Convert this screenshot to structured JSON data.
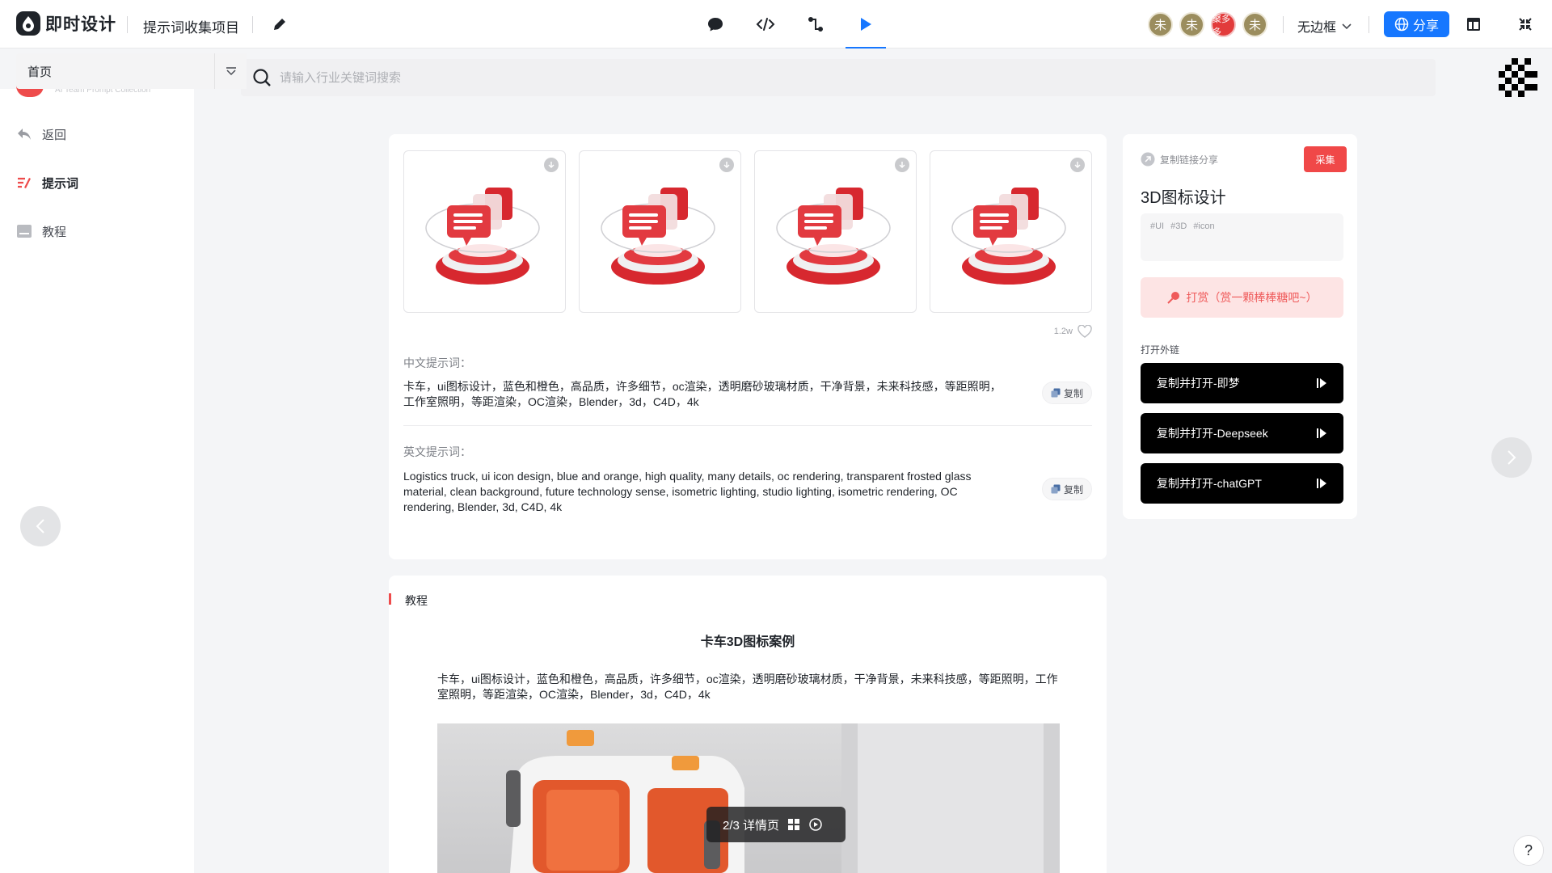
{
  "app": {
    "logo_text": "即时设计",
    "project_name": "提示词收集项目"
  },
  "mode_tabs": [
    {
      "icon": "comment-icon"
    },
    {
      "icon": "code-icon"
    },
    {
      "icon": "connect-icon"
    },
    {
      "icon": "play-icon",
      "active": true
    }
  ],
  "collaborators": [
    {
      "label": "未"
    },
    {
      "label": "未"
    },
    {
      "label": "聚多多"
    },
    {
      "label": "未"
    }
  ],
  "toolbar": {
    "frame_mode": "无边框",
    "share_label": "分享",
    "accent_color": "#1677ff"
  },
  "nav": {
    "page_select": "首页",
    "search_placeholder": "请输入行业关键词搜索",
    "search_value": ""
  },
  "sidebar": {
    "peek_text": "AI Team Prompt Collection",
    "items": [
      {
        "label": "返回",
        "icon": "back-icon"
      },
      {
        "label": "提示词",
        "icon": "prompt-icon",
        "active": true
      },
      {
        "label": "教程",
        "icon": "tutorial-icon"
      }
    ]
  },
  "detail": {
    "views": "1.2w",
    "cn_label": "中文提示词：",
    "cn_prompt": "卡车，ui图标设计，蓝色和橙色，高品质，许多细节，oc渲染，透明磨砂玻璃材质，干净背景，未来科技感，等距照明，工作室照明，等距渲染，OC渲染，Blender，3d，C4D，4k",
    "en_label": "英文提示词：",
    "en_prompt": "Logistics truck, ui icon design, blue and orange, high quality, many details, oc rendering, transparent frosted glass material, clean background, future technology sense, isometric lighting, studio lighting, isometric rendering, OC rendering, Blender, 3d, C4D, 4k",
    "copy_label": "复制"
  },
  "tutorial": {
    "label": "教程",
    "title": "卡车3D图标案例",
    "body": "卡车，ui图标设计，蓝色和橙色，高品质，许多细节，oc渲染，透明磨砂玻璃材质，干净背景，未来科技感，等距照明，工作室照明，等距渲染，OC渲染，Blender，3d，C4D，4k"
  },
  "pager": {
    "text": "2/3 详情页"
  },
  "panel": {
    "link_share": "复制链接分享",
    "collect_label": "采集",
    "title": "3D图标设计",
    "tags": [
      "#UI",
      "#3D",
      "#icon"
    ],
    "tip_label": "打赏（赏一颗棒棒糖吧~）",
    "ext_label": "打开外链",
    "ext_buttons": [
      "复制并打开-即梦",
      "复制并打开-Deepseek",
      "复制并打开-chatGPT"
    ],
    "brand_red": "#f04848"
  },
  "help_label": "?"
}
